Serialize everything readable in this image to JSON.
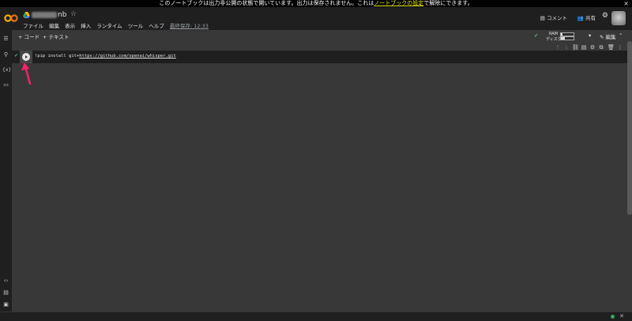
{
  "banner": {
    "text_before": "このノートブックは出力非公開の状態で開いています。出力は保存されません。これは",
    "link_text": "ノートブックの設定",
    "text_after": "で解除にできます。",
    "close": "×"
  },
  "header": {
    "title_suffix": "nb",
    "star": "☆",
    "menu": [
      "ファイル",
      "編集",
      "表示",
      "挿入",
      "ランタイム",
      "ツール",
      "ヘルプ"
    ],
    "last_edited": "最終保存: 12:33",
    "comment_label": "コメント",
    "share_label": "共有"
  },
  "toolbar": {
    "add_code": "+ コード",
    "add_text": "+ テキスト",
    "ram_label": "RAM",
    "disk_label": "ディスク",
    "edit_label": "編集"
  },
  "cell": {
    "code_prefix": "!pip install git+",
    "code_url": "https://github.com/openai/whisper.git"
  },
  "colors": {
    "accent_arrow": "#ff1f6b",
    "check_green": "#5bb974",
    "banner_link": "#e8e800"
  }
}
